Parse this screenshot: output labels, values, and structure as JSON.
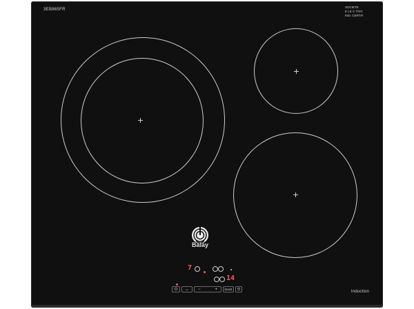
{
  "product": {
    "model": "3EB865FR",
    "certifications": [
      "SOCIETE",
      "E LE C TRIC",
      "IND. CERTIF."
    ],
    "brand": "Balay",
    "type_label": "Induction"
  },
  "zones": [
    {
      "name": "large-left-zone",
      "rings": 2
    },
    {
      "name": "small-top-right-zone",
      "rings": 1
    },
    {
      "name": "medium-bottom-right-zone",
      "rings": 1
    }
  ],
  "controls": {
    "left_display": "7",
    "right_display": "14",
    "power_icon": "power-icon",
    "minus_label": "−",
    "plus_label": "+",
    "boost_label": "boost",
    "timer_label": "⏲",
    "lock_icon": "lock-icon",
    "zone_select_label": "↔"
  },
  "colors": {
    "glass": "#101010",
    "markings": "#cfcfcf",
    "display_red": "#ff5a5a"
  }
}
